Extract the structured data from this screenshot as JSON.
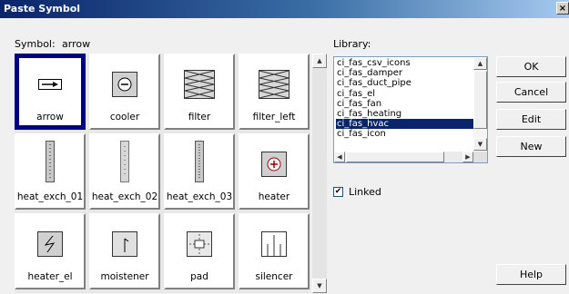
{
  "dialog": {
    "title": "Paste Symbol",
    "close": "×"
  },
  "symbol": {
    "label": "Symbol:",
    "value": "arrow"
  },
  "library": {
    "label": "Library:",
    "items": [
      "ci_fas_csv_icons",
      "ci_fas_damper",
      "ci_fas_duct_pipe",
      "ci_fas_el",
      "ci_fas_fan",
      "ci_fas_heating",
      "ci_fas_hvac",
      "ci_fas_icon"
    ],
    "selected": "ci_fas_hvac"
  },
  "tiles": [
    {
      "label": "arrow",
      "icon": "arrow-icon",
      "selected": true
    },
    {
      "label": "cooler",
      "icon": "cooler-icon"
    },
    {
      "label": "filter",
      "icon": "filter-icon"
    },
    {
      "label": "filter_left",
      "icon": "filter-left-icon"
    },
    {
      "label": "heat_exch_01",
      "icon": "heat-exchanger-icon"
    },
    {
      "label": "heat_exch_02",
      "icon": "heat-exchanger-icon"
    },
    {
      "label": "heat_exch_03",
      "icon": "heat-exchanger-icon"
    },
    {
      "label": "heater",
      "icon": "heater-icon"
    },
    {
      "label": "heater_el",
      "icon": "electric-heater-icon"
    },
    {
      "label": "moistener",
      "icon": "moistener-icon"
    },
    {
      "label": "pad",
      "icon": "pad-icon"
    },
    {
      "label": "silencer",
      "icon": "silencer-icon"
    }
  ],
  "buttons": {
    "ok": "OK",
    "cancel": "Cancel",
    "edit": "Edit",
    "new": "New",
    "help": "Help"
  },
  "linked": {
    "label": "Linked",
    "checked": true,
    "mark": "✔"
  },
  "colors": {
    "selection": "#000080",
    "title_start": "#0a246a"
  }
}
